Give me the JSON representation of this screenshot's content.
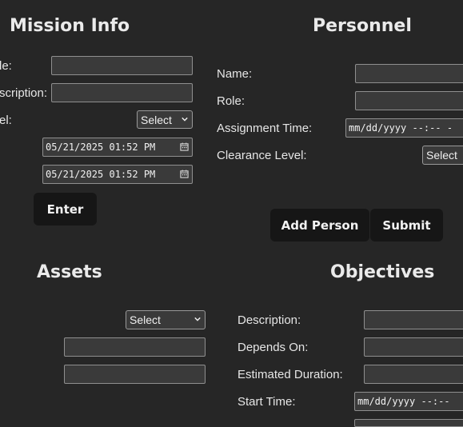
{
  "mission_info": {
    "title": "Mission Info",
    "fields": [
      "le:",
      "scription:",
      "el:"
    ],
    "level_select": "Select",
    "start_datetime": "05/21/2025 01:52 PM",
    "end_datetime": "05/21/2025 01:52 PM",
    "enter_button": "Enter"
  },
  "personnel": {
    "title": "Personnel",
    "fields": [
      "Name:",
      "Role:",
      "Assignment Time:",
      "Clearance Level:"
    ],
    "assignment_time_placeholder": "mm/dd/yyyy --:-- -",
    "clearance_select": "Select",
    "add_person_button": "Add Person",
    "submit_button": "Submit"
  },
  "assets": {
    "title": "Assets",
    "type_select": "Select"
  },
  "objectives": {
    "title": "Objectives",
    "fields": [
      "Description:",
      "Depends On:",
      "Estimated Duration:",
      "Start Time:"
    ],
    "start_time_placeholder": "mm/dd/yyyy --:--"
  },
  "icons": {
    "calendar": "calendar-icon",
    "dropdown": "chevron-down-icon"
  }
}
